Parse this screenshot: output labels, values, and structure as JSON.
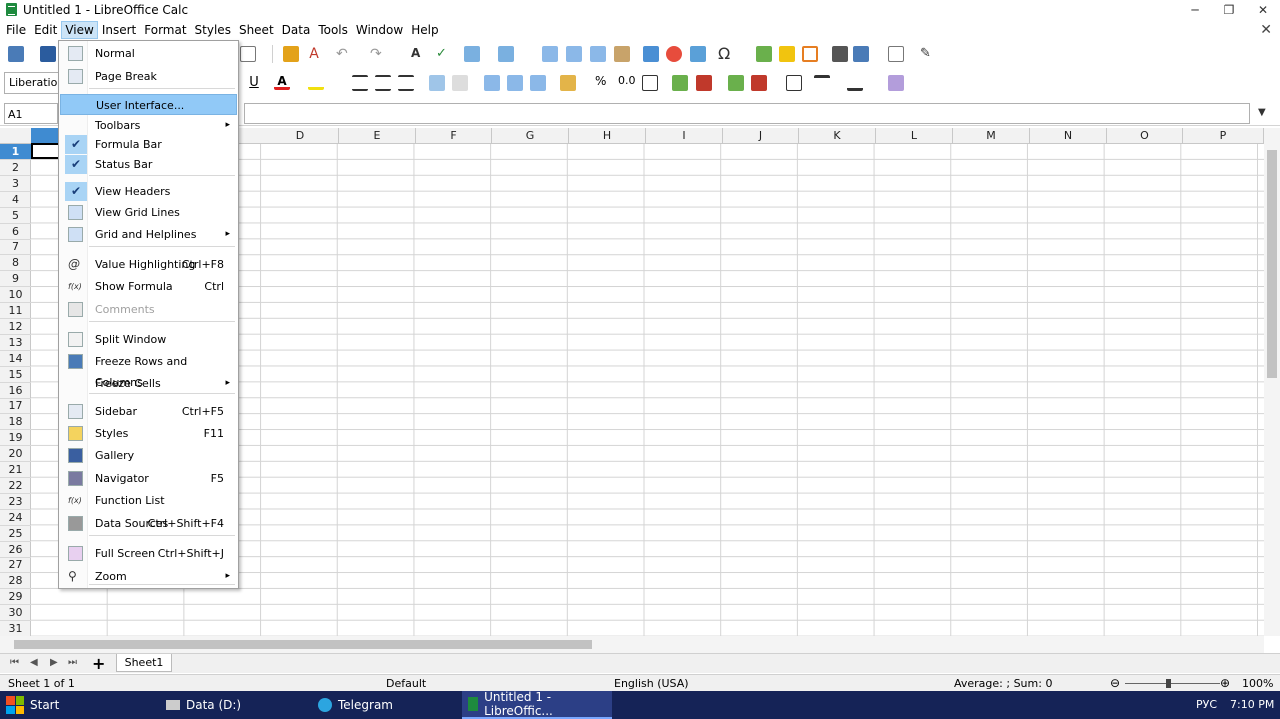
{
  "window": {
    "title": "Untitled 1 - LibreOffice Calc",
    "minimize": "─",
    "maximize": "❐",
    "close": "✕"
  },
  "menubar": [
    {
      "key": "file",
      "label": "File"
    },
    {
      "key": "edit",
      "label": "Edit"
    },
    {
      "key": "view",
      "label": "View"
    },
    {
      "key": "insert",
      "label": "Insert"
    },
    {
      "key": "format",
      "label": "Format"
    },
    {
      "key": "styles",
      "label": "Styles"
    },
    {
      "key": "sheet",
      "label": "Sheet"
    },
    {
      "key": "data",
      "label": "Data"
    },
    {
      "key": "tools",
      "label": "Tools"
    },
    {
      "key": "window",
      "label": "Window"
    },
    {
      "key": "help",
      "label": "Help"
    }
  ],
  "menubar_close": "✕",
  "formatting": {
    "font_name": "Liberation S"
  },
  "formula_bar": {
    "name_box": "A1",
    "content": ""
  },
  "columns": [
    "D",
    "E",
    "F",
    "G",
    "H",
    "I",
    "J",
    "K",
    "L",
    "M",
    "N",
    "O",
    "P"
  ],
  "rows": [
    "1",
    "2",
    "3",
    "4",
    "5",
    "6",
    "7",
    "8",
    "9",
    "10",
    "11",
    "12",
    "13",
    "14",
    "15",
    "16",
    "17",
    "18",
    "19",
    "20",
    "21",
    "22",
    "23",
    "24",
    "25",
    "26",
    "27",
    "28",
    "29",
    "30",
    "31"
  ],
  "view_menu": {
    "items": [
      {
        "label": "Normal",
        "icon": "normal-view-icon"
      },
      {
        "label": "Page Break",
        "icon": "page-break-icon"
      },
      {
        "label": "User Interface...",
        "highlighted": true
      },
      {
        "label": "Toolbars",
        "submenu": true
      },
      {
        "label": "Formula Bar",
        "checked": true
      },
      {
        "label": "Status Bar",
        "checked": true
      },
      {
        "label": "View Headers",
        "checked": true
      },
      {
        "label": "View Grid Lines",
        "icon": "grid-lines-icon"
      },
      {
        "label": "Grid and Helplines",
        "submenu": true,
        "icon": "grid-helplines-icon"
      },
      {
        "label": "Value Highlighting",
        "shortcut": "Ctrl+F8",
        "icon": "value-highlighting-icon"
      },
      {
        "label": "Show Formula",
        "shortcut": "Ctrl",
        "icon": "formula-icon"
      },
      {
        "label": "Comments",
        "disabled": true,
        "icon": "comments-icon"
      },
      {
        "label": "Split Window",
        "icon": "split-window-icon"
      },
      {
        "label": "Freeze Rows and Columns",
        "icon": "freeze-icon"
      },
      {
        "label": "Freeze Cells",
        "submenu": true
      },
      {
        "label": "Sidebar",
        "shortcut": "Ctrl+F5",
        "icon": "sidebar-icon"
      },
      {
        "label": "Styles",
        "shortcut": "F11",
        "icon": "styles-icon"
      },
      {
        "label": "Gallery",
        "icon": "gallery-icon"
      },
      {
        "label": "Navigator",
        "shortcut": "F5",
        "icon": "navigator-icon"
      },
      {
        "label": "Function List",
        "icon": "function-list-icon"
      },
      {
        "label": "Data Sources",
        "shortcut": "Ctrl+Shift+F4",
        "icon": "data-sources-icon"
      },
      {
        "label": "Full Screen",
        "shortcut": "Ctrl+Shift+J",
        "icon": "full-screen-icon"
      },
      {
        "label": "Zoom",
        "submenu": true,
        "icon": "zoom-icon"
      }
    ],
    "submenu_arrow": "▸",
    "check_mark": "✔"
  },
  "sheet_tabs": {
    "tabs": [
      "Sheet1"
    ],
    "add": "+",
    "nav": [
      "⏮",
      "◀",
      "▶",
      "⏭"
    ]
  },
  "status_bar": {
    "sheet": "Sheet 1 of 1",
    "page_style": "Default",
    "language": "English (USA)",
    "selection": "Average: ; Sum: 0",
    "zoom": "100%",
    "zoom_minus": "⊖",
    "zoom_plus": "⊕"
  },
  "taskbar": {
    "start": "Start",
    "tasks": [
      {
        "label": "Data (D:)"
      },
      {
        "label": "Telegram"
      },
      {
        "label": "Untitled 1 - LibreOffic...",
        "active": true
      }
    ],
    "language": "РУС",
    "time": "7:10 PM"
  }
}
